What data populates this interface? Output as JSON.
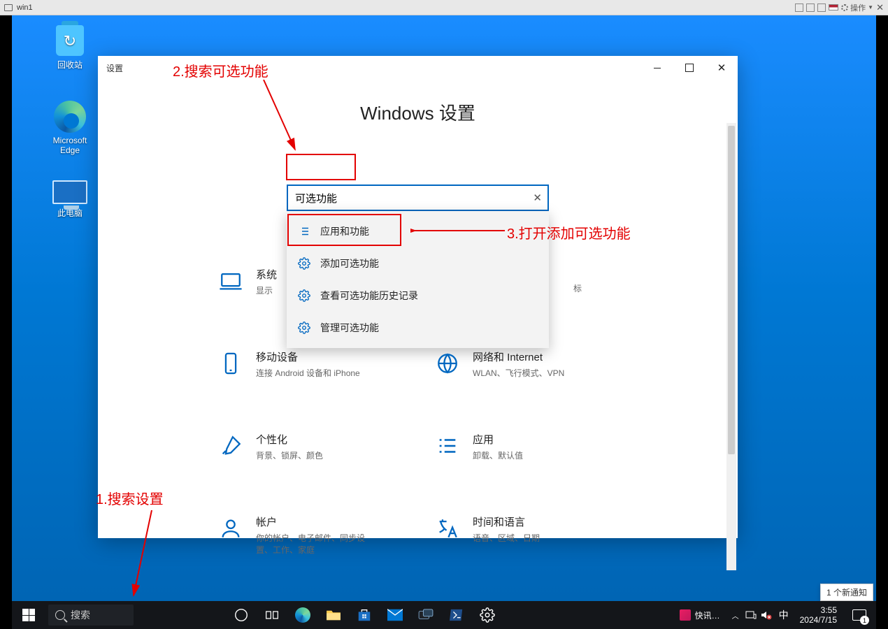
{
  "vm": {
    "title": "win1",
    "action_label": "操作"
  },
  "desktop_icons": {
    "recycle_bin": "回收站",
    "edge": "Microsoft Edge",
    "this_pc": "此电脑"
  },
  "settings": {
    "window_name": "设置",
    "title": "Windows 设置",
    "search_value": "可选功能",
    "suggestions": [
      {
        "icon": "list-icon",
        "label": "应用和功能"
      },
      {
        "icon": "gear-icon",
        "label": "添加可选功能"
      },
      {
        "icon": "gear-icon",
        "label": "查看可选功能历史记录"
      },
      {
        "icon": "gear-icon",
        "label": "管理可选功能"
      }
    ],
    "categories": {
      "system": {
        "title": "系统",
        "desc": "显示",
        "desc_tail": "标"
      },
      "devices": {
        "title": "移动设备",
        "desc": "连接 Android 设备和 iPhone"
      },
      "network": {
        "title": "网络和 Internet",
        "desc": "WLAN、飞行模式、VPN"
      },
      "personal": {
        "title": "个性化",
        "desc": "背景、锁屏、颜色"
      },
      "apps": {
        "title": "应用",
        "desc": "卸载、默认值"
      },
      "accounts": {
        "title": "帐户",
        "desc": "你的帐户、电子邮件、同步设置、工作、家庭"
      },
      "time": {
        "title": "时间和语言",
        "desc": "语音、区域、日期"
      }
    }
  },
  "annotations": {
    "a1": "1.搜索设置",
    "a2": "2.搜索可选功能",
    "a3": "3.打开添加可选功能"
  },
  "taskbar": {
    "search_placeholder": "搜索",
    "news_label": "快讯…",
    "ime": "中",
    "time": "3:55",
    "date": "2024/7/15",
    "notif_count": "1",
    "notif_tooltip": "1 个新通知"
  },
  "colors": {
    "accent": "#0067c0",
    "anno": "#e30000"
  }
}
